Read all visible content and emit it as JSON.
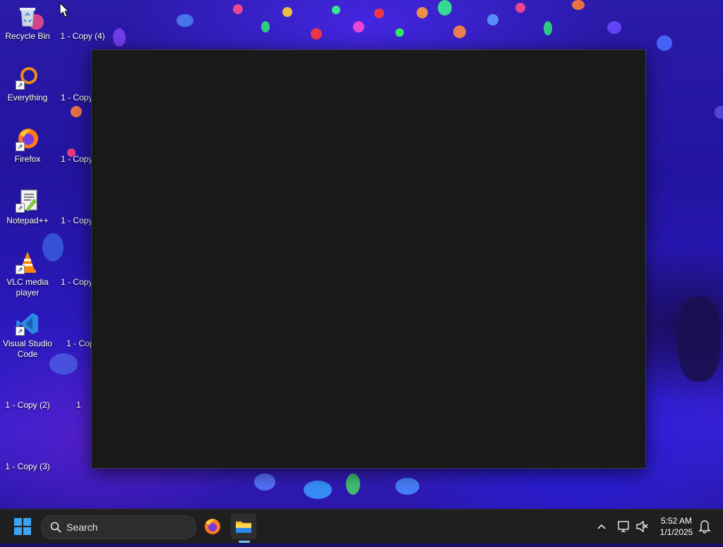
{
  "desktop": {
    "icons": [
      {
        "label": "Recycle Bin"
      },
      {
        "label": "Everything"
      },
      {
        "label": "Firefox"
      },
      {
        "label": "Notepad++"
      },
      {
        "label": "VLC media player"
      },
      {
        "label": "Visual Studio Code"
      },
      {
        "label": "1 - Copy (2)"
      },
      {
        "label": "1 - Copy (3)"
      },
      {
        "label": "1 - Copy (4)"
      },
      {
        "label": "1 - Copy"
      },
      {
        "label": "1 - Copy"
      },
      {
        "label": "1 - Copy"
      },
      {
        "label": "1 - Copy"
      },
      {
        "label": "1 - Cop"
      },
      {
        "label": "1"
      }
    ]
  },
  "taskbar": {
    "search_placeholder": "Search",
    "apps": [
      {
        "icon": "firefox-icon"
      },
      {
        "icon": "file-explorer-icon",
        "active": true
      }
    ],
    "clock": {
      "time": "5:52 AM",
      "date": "1/1/2025"
    }
  },
  "colors": {
    "window_bg": "#191919",
    "taskbar_bg": "#1f1f1f",
    "accent": "#3aa5f5"
  }
}
